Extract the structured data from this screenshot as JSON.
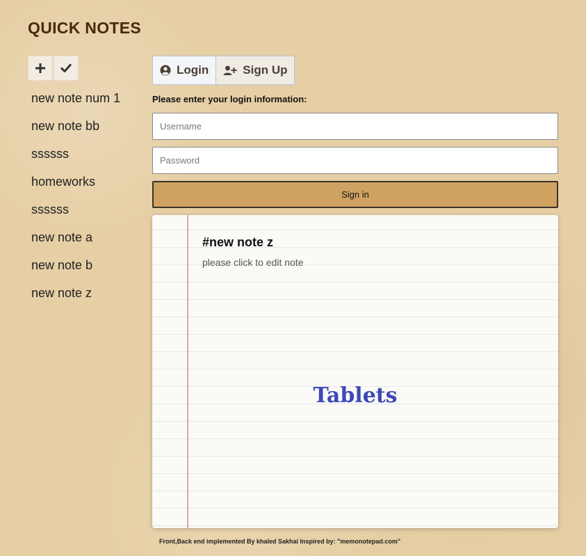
{
  "app": {
    "title": "QUICK NOTES"
  },
  "toolbar": {
    "add_icon": "plus-icon",
    "save_icon": "check-icon"
  },
  "notes": [
    {
      "title": "new note num 1"
    },
    {
      "title": "new note bb"
    },
    {
      "title": "ssssss"
    },
    {
      "title": "homeworks"
    },
    {
      "title": "ssssss"
    },
    {
      "title": "new note a"
    },
    {
      "title": "new note b"
    },
    {
      "title": "new note z"
    }
  ],
  "auth": {
    "tabs": [
      {
        "label": "Login",
        "icon": "user-circle-icon",
        "active": true
      },
      {
        "label": "Sign Up",
        "icon": "user-plus-icon",
        "active": false
      }
    ],
    "prompt": "Please enter your login information:",
    "username": {
      "placeholder": "Username",
      "value": ""
    },
    "password": {
      "placeholder": "Password",
      "value": ""
    },
    "submit_label": "Sign in"
  },
  "editor": {
    "title": "#new note z",
    "hint": "please click to edit note",
    "watermark": "Tablets"
  },
  "footer": {
    "credit": "Front,Back end implemented By khaled Sakhai Inspired by: \"memonotepad.com\""
  },
  "colors": {
    "page_background": "#e6cfa5",
    "title": "#4a2a0c",
    "signin_button": "#cfa262",
    "paper": "#fbfaf7",
    "paper_margin_line": "#d8a8a8",
    "watermark": "#3d48b8"
  }
}
